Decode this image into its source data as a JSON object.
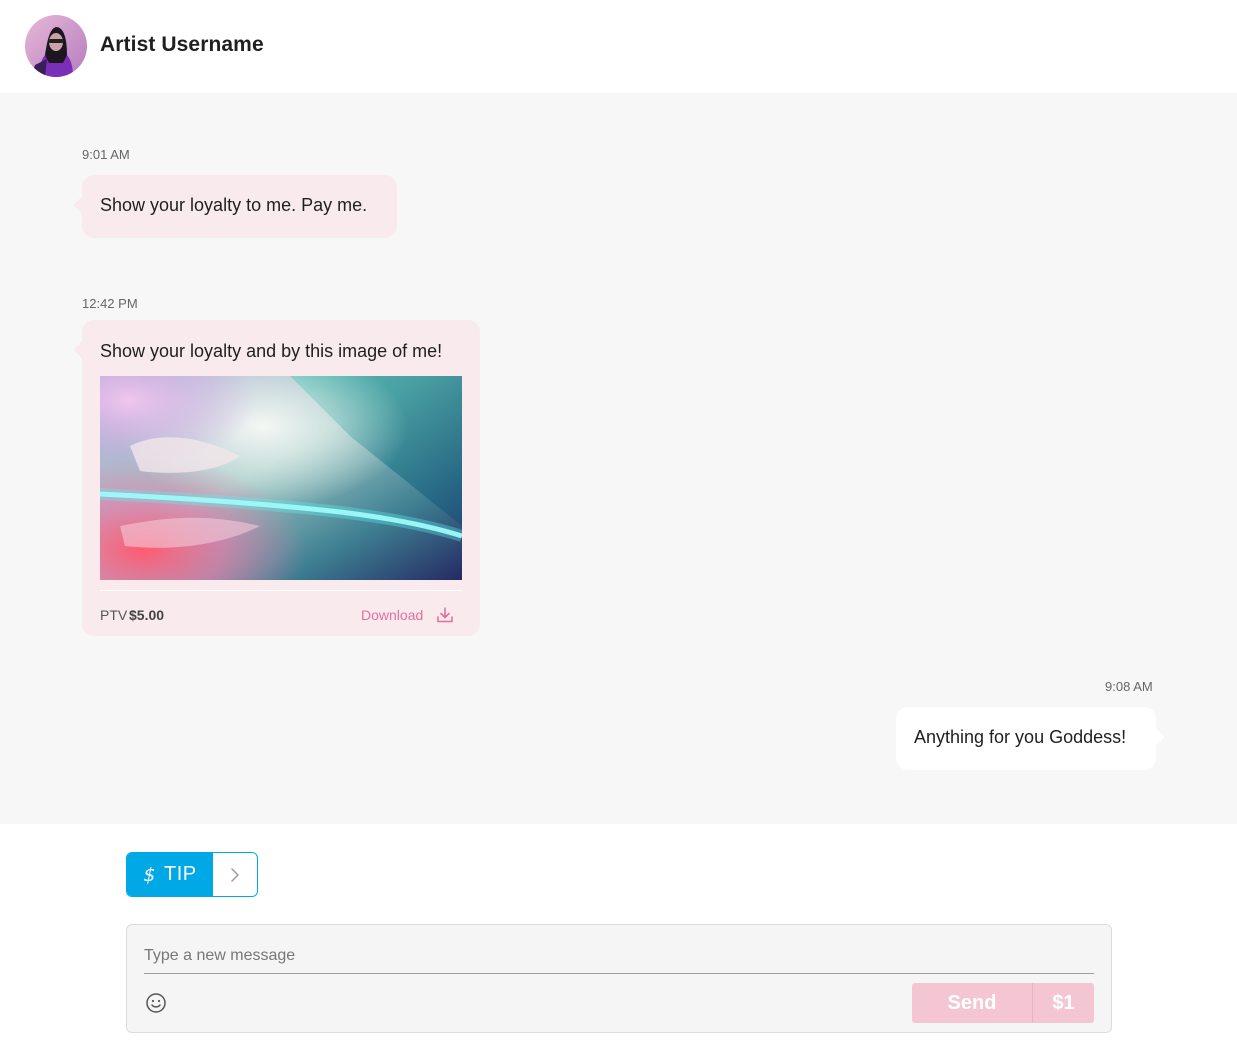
{
  "header": {
    "username": "Artist Username",
    "avatar": "artist-avatar"
  },
  "messages": [
    {
      "time": "9:01 AM",
      "direction": "incoming",
      "text": "Show your loyalty to me. Pay me."
    },
    {
      "time": "12:42 PM",
      "direction": "incoming",
      "text": "Show your loyalty and by this image of me!",
      "media": {
        "ptv_label": "PTV",
        "price": "$5.00",
        "download_label": "Download",
        "download_icon": "download-icon"
      }
    },
    {
      "time": "9:08 AM",
      "direction": "outgoing",
      "text": "Anything for you Goddess!"
    }
  ],
  "tip": {
    "icon": "dollar-icon",
    "label": "TIP",
    "chevron_icon": "chevron-right-icon"
  },
  "composer": {
    "placeholder": "Type a new message",
    "emoji_icon": "smiley-icon",
    "send_label": "Send",
    "price_label": "$1"
  },
  "colors": {
    "accent_blue": "#00a9e5",
    "incoming_bubble": "#f9eaee",
    "download_pink": "#e36f9e",
    "send_disabled": "#f4c6d4",
    "chat_bg": "#f7f7f7"
  }
}
